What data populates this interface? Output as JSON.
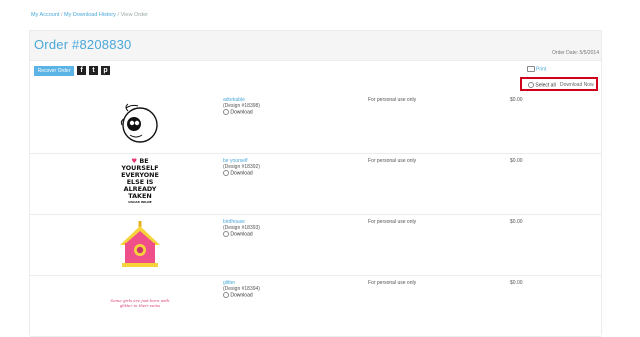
{
  "breadcrumb": {
    "account": "My Account",
    "sep1": " / ",
    "history": "My Download History",
    "sep2": " / ",
    "current": "View Order"
  },
  "order": {
    "title": "Order #8208830",
    "date": "Order Date: 5/5/2014"
  },
  "toolbar": {
    "reorder_label": "Recover Order",
    "facebook": "f",
    "twitter": "t",
    "pinterest": "p",
    "print_label": "Print"
  },
  "download_box": {
    "select_all_label": "Select all",
    "download_now_label": "Download Now"
  },
  "items": [
    {
      "name": "adorkable",
      "design_number": "(Design #18398)",
      "download_label": "Download",
      "license": "For personal use only",
      "price": "$0.00"
    },
    {
      "name": "be yourself",
      "design_number": "(Design #18392)",
      "download_label": "Download",
      "license": "For personal use only",
      "price": "$0.00"
    },
    {
      "name": "birdhouse",
      "design_number": "(Design #18393)",
      "download_label": "Download",
      "license": "For personal use only",
      "price": "$0.00"
    },
    {
      "name": "glitter",
      "design_number": "(Design #18394)",
      "download_label": "Download",
      "license": "For personal use only",
      "price": "$0.00"
    }
  ],
  "quote": [
    "BE",
    "YOURSELF",
    "EVERYONE",
    "ELSE IS",
    "ALREADY",
    "TAKEN",
    "OSCAR WILDE"
  ],
  "glitter_text": "Some girls are just born with glitter in their veins",
  "colors": {
    "accent": "#4aa8d8",
    "button": "#5cb3e6",
    "highlight": "#d0021b",
    "birdhouse_body": "#f0508a",
    "birdhouse_roof": "#f7d33a"
  }
}
